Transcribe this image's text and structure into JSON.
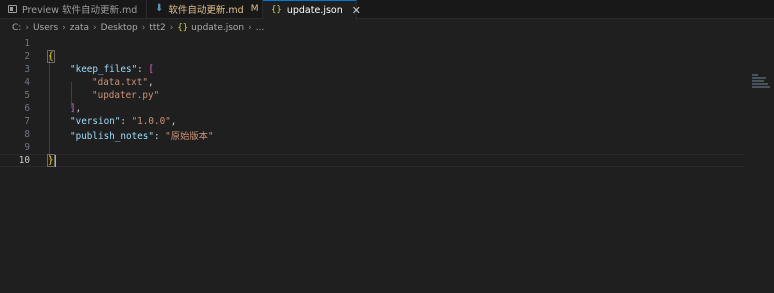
{
  "tabs": [
    {
      "label": "Preview 软件自动更新.md",
      "icon": "preview-icon"
    },
    {
      "label": "软件自动更新.md",
      "icon": "markdown-icon",
      "badge": "M"
    },
    {
      "label": "update.json",
      "icon": "json-braces-icon",
      "close": "✕"
    }
  ],
  "breadcrumb": {
    "items": [
      "C:",
      "Users",
      "zata",
      "Desktop",
      "ttt2"
    ],
    "file": "update.json",
    "json_icon": "{}",
    "tail": "..."
  },
  "editor": {
    "line_numbers": [
      "1",
      "2",
      "3",
      "4",
      "5",
      "6",
      "7",
      "8",
      "9",
      "10"
    ],
    "current_line": "10",
    "tokens": {
      "open_brace": "{",
      "close_brace": "}",
      "keep_files_key": "\"keep_files\"",
      "colon": ": ",
      "open_bracket": "[",
      "close_bracket": "]",
      "file1": "\"data.txt\"",
      "file2": "\"updater.py\"",
      "comma": ",",
      "version_key": "\"version\"",
      "version_value": "\"1.0.0\"",
      "notes_key": "\"publish_notes\"",
      "notes_value": "\"原始版本\""
    }
  },
  "colors": {
    "background": "#1f1f1f",
    "accent": "#0078d4",
    "key": "#9cdcfe",
    "string": "#ce9178",
    "brace": "#ffd700",
    "bracket": "#da70d6",
    "modified": "#e2c08d"
  }
}
